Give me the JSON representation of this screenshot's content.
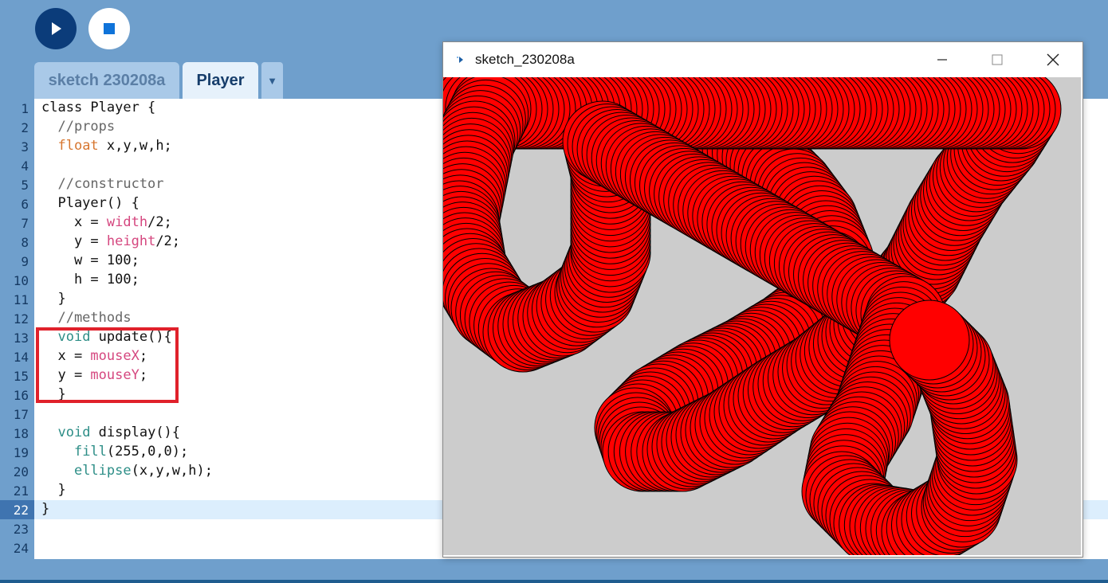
{
  "toolbar": {
    "run_icon": "play-icon",
    "stop_icon": "stop-icon",
    "accent_run": "#0b3c7a",
    "accent_stop": "#0f73d9"
  },
  "tabs": [
    {
      "label": "sketch 230208a",
      "active": false
    },
    {
      "label": "Player",
      "active": true
    }
  ],
  "tab_menu_icon": "▼",
  "editor": {
    "highlighted_line": 22,
    "lines": [
      {
        "n": "1",
        "text": "class Player {"
      },
      {
        "n": "2",
        "text": "  //props"
      },
      {
        "n": "3",
        "text": "  float x,y,w,h;"
      },
      {
        "n": "4",
        "text": ""
      },
      {
        "n": "5",
        "text": "  //constructor"
      },
      {
        "n": "6",
        "text": "  Player() {"
      },
      {
        "n": "7",
        "text": "    x = width/2;"
      },
      {
        "n": "8",
        "text": "    y = height/2;"
      },
      {
        "n": "9",
        "text": "    w = 100;"
      },
      {
        "n": "10",
        "text": "    h = 100;"
      },
      {
        "n": "11",
        "text": "  }"
      },
      {
        "n": "12",
        "text": "  //methods"
      },
      {
        "n": "13",
        "text": "  void update(){"
      },
      {
        "n": "14",
        "text": "  x = mouseX;"
      },
      {
        "n": "15",
        "text": "  y = mouseY;"
      },
      {
        "n": "16",
        "text": "  }"
      },
      {
        "n": "17",
        "text": ""
      },
      {
        "n": "18",
        "text": "  void display(){"
      },
      {
        "n": "19",
        "text": "    fill(255,0,0);"
      },
      {
        "n": "20",
        "text": "    ellipse(x,y,w,h);"
      },
      {
        "n": "21",
        "text": "  }"
      },
      {
        "n": "22",
        "text": "}"
      },
      {
        "n": "23",
        "text": ""
      },
      {
        "n": "24",
        "text": ""
      }
    ]
  },
  "sketch_window": {
    "title": "sketch_230208a",
    "minimize_icon": "minimize-icon",
    "maximize_icon": "maximize-icon",
    "close_icon": "close-icon",
    "background": "#cccccc",
    "fill": "#ff0000"
  }
}
